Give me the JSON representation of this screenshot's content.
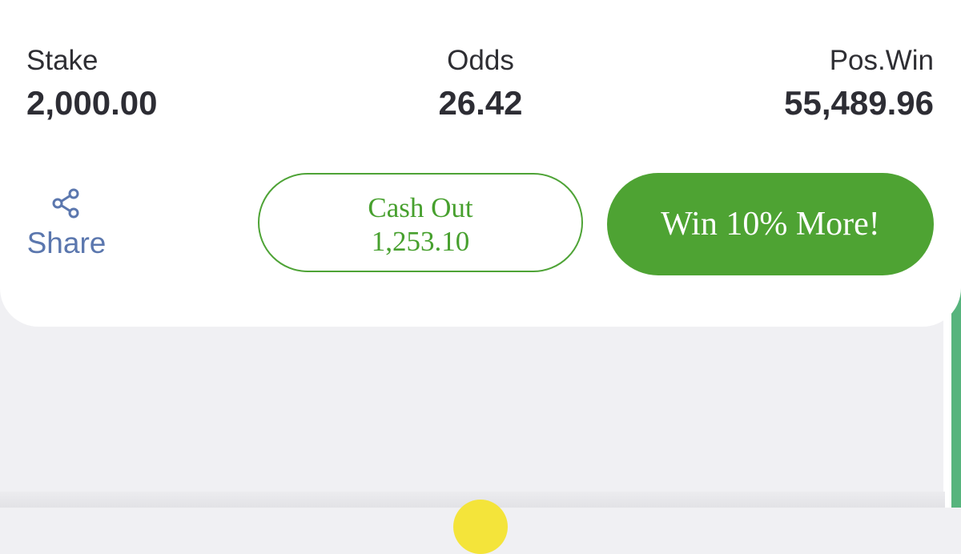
{
  "stats": {
    "stake": {
      "label": "Stake",
      "value": "2,000.00"
    },
    "odds": {
      "label": "Odds",
      "value": "26.42"
    },
    "pos_win": {
      "label": "Pos.Win",
      "value": "55,489.96"
    }
  },
  "actions": {
    "share": {
      "label": "Share",
      "icon": "share-icon"
    },
    "cash_out": {
      "label": "Cash Out",
      "amount": "1,253.10"
    },
    "win_more": {
      "label": "Win 10% More!"
    }
  },
  "colors": {
    "accent_green": "#4ea333",
    "share_blue": "#5b77ae",
    "edge_green": "#57b47d",
    "nav_yellow": "#f4e43a"
  }
}
